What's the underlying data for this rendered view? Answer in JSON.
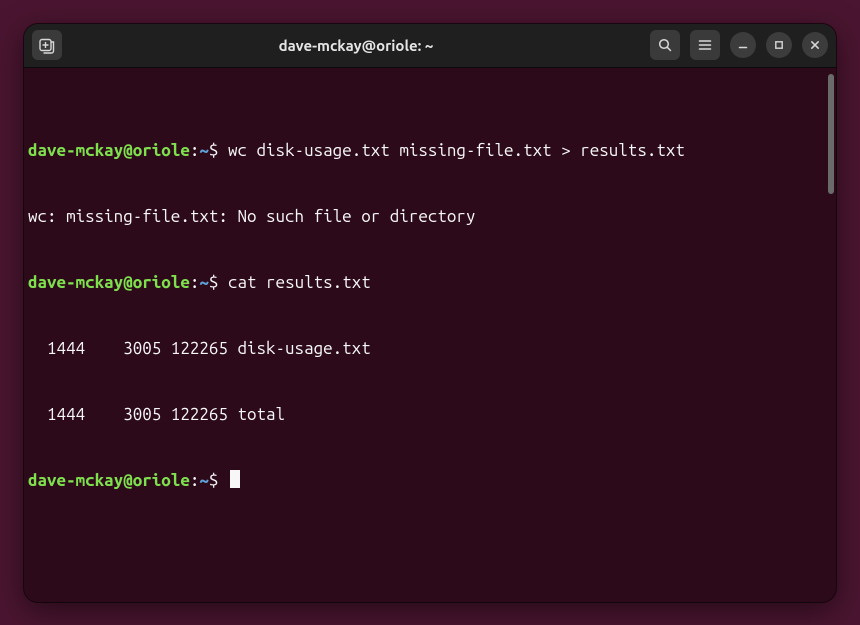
{
  "titlebar": {
    "title": "dave-mckay@oriole: ~"
  },
  "prompt": {
    "user_host": "dave-mckay@oriole",
    "colon": ":",
    "path": "~",
    "dollar": "$"
  },
  "lines": {
    "cmd1": " wc disk-usage.txt missing-file.txt > results.txt",
    "out1": "wc: missing-file.txt: No such file or directory",
    "cmd2": " cat results.txt",
    "out2": "  1444    3005 122265 disk-usage.txt",
    "out3": "  1444    3005 122265 total",
    "cmd3": " "
  },
  "colors": {
    "user": "#7fe04e",
    "path": "#5f9fd6",
    "bg": "#2c0a1a",
    "desktop": "#4a1530"
  }
}
